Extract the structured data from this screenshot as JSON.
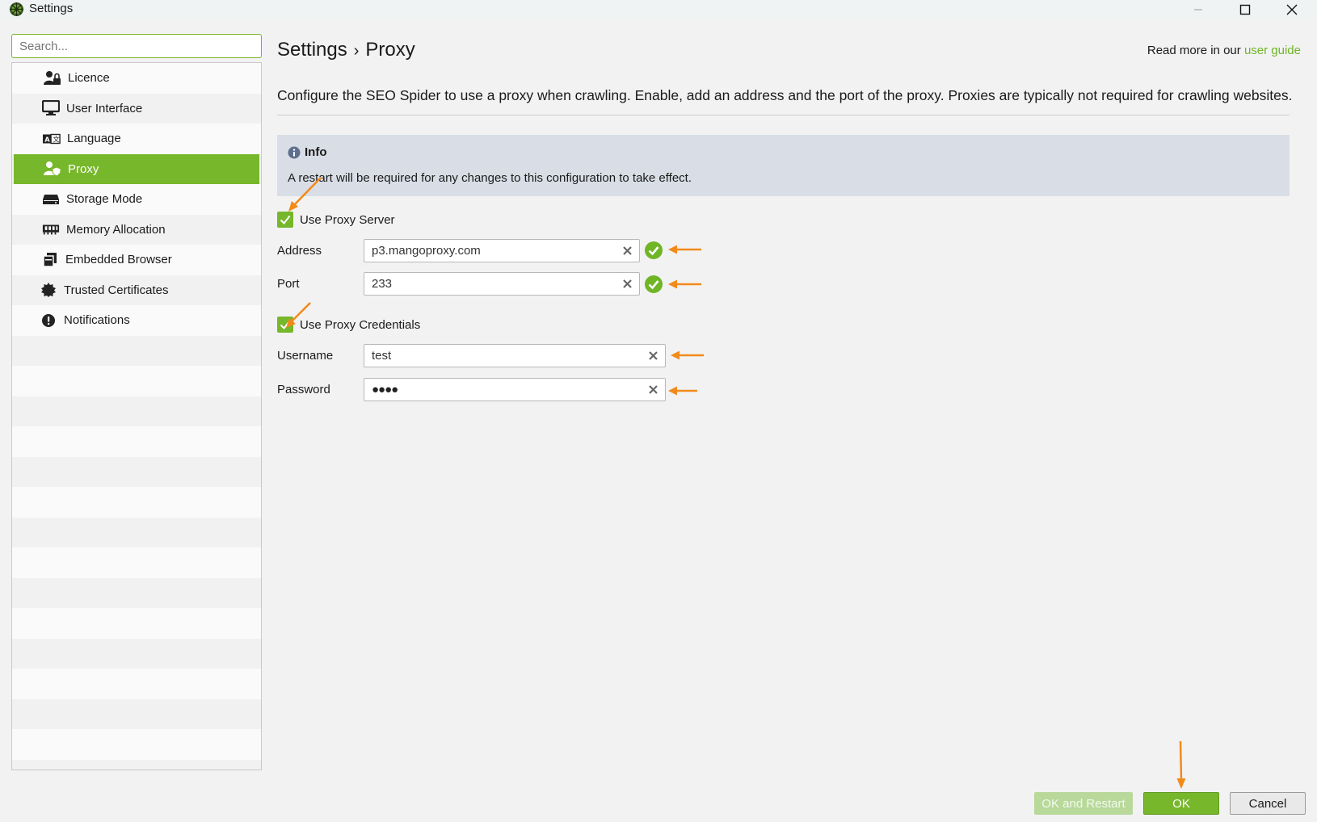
{
  "window": {
    "title": "Settings",
    "icon": "spider-logo-icon",
    "controls": [
      "minimize-icon",
      "maximize-icon",
      "close-icon"
    ]
  },
  "sidebar": {
    "search_placeholder": "Search...",
    "items": [
      {
        "label": "Licence",
        "icon": "user-lock-icon",
        "active": false
      },
      {
        "label": "User Interface",
        "icon": "monitor-icon",
        "active": false
      },
      {
        "label": "Language",
        "icon": "language-icon",
        "active": false
      },
      {
        "label": "Proxy",
        "icon": "user-shield-icon",
        "active": true
      },
      {
        "label": "Storage Mode",
        "icon": "hard-drive-icon",
        "active": false
      },
      {
        "label": "Memory Allocation",
        "icon": "memory-icon",
        "active": false
      },
      {
        "label": "Embedded Browser",
        "icon": "browser-windows-icon",
        "active": false
      },
      {
        "label": "Trusted Certificates",
        "icon": "certificate-icon",
        "active": false
      },
      {
        "label": "Notifications",
        "icon": "exclamation-icon",
        "active": false
      }
    ]
  },
  "header": {
    "breadcrumb_root": "Settings",
    "breadcrumb_sep": "›",
    "breadcrumb_current": "Proxy",
    "guide_prefix": "Read more in our",
    "guide_link": "user guide"
  },
  "main": {
    "description": "Configure the SEO Spider to use a proxy when crawling. Enable, add an address and the port of the proxy. Proxies are typically not required for crawling websites.",
    "info": {
      "title": "Info",
      "text": "A restart will be required for any changes to this configuration to take effect."
    },
    "use_proxy_server": {
      "label": "Use Proxy Server",
      "checked": true
    },
    "address": {
      "label": "Address",
      "value": "p3.mangoproxy.com",
      "valid": true
    },
    "port": {
      "label": "Port",
      "value": "233",
      "valid": true
    },
    "use_proxy_credentials": {
      "label": "Use Proxy Credentials",
      "checked": true
    },
    "username": {
      "label": "Username",
      "value": "test"
    },
    "password": {
      "label": "Password",
      "value": "●●●●"
    }
  },
  "footer": {
    "ok_restart_label": "OK and Restart",
    "ok_label": "OK",
    "cancel_label": "Cancel"
  },
  "colors": {
    "accent": "#77b72b",
    "link": "#6fb526",
    "annotation_arrow": "#f28a1a",
    "info_bg": "#d9dee6"
  }
}
